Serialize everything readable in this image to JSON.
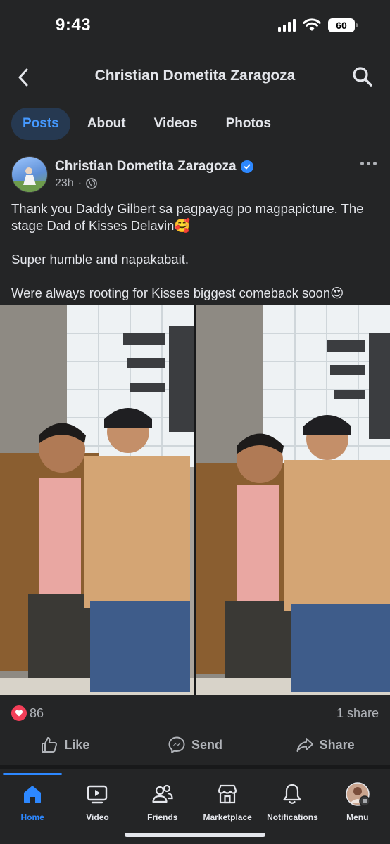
{
  "status_bar": {
    "time": "9:43",
    "battery": "60"
  },
  "header": {
    "title": "Christian Dometita Zaragoza"
  },
  "tabs": [
    {
      "label": "Posts",
      "active": true
    },
    {
      "label": "About",
      "active": false
    },
    {
      "label": "Videos",
      "active": false
    },
    {
      "label": "Photos",
      "active": false
    }
  ],
  "post": {
    "author": "Christian Dometita Zaragoza",
    "time": "23h",
    "separator": "·",
    "text": [
      "Thank you Daddy Gilbert sa pagpayag po magpapicture. The stage Dad of Kisses Delavin🥰",
      "Super humble and napakabait.",
      "Were always rooting for Kisses biggest comeback soon😍"
    ],
    "reaction_count": "86",
    "shares": "1 share"
  },
  "actions": {
    "like": "Like",
    "send": "Send",
    "share": "Share"
  },
  "tab_bar": [
    {
      "label": "Home",
      "icon": "home-icon",
      "active": true
    },
    {
      "label": "Video",
      "icon": "video-icon",
      "active": false
    },
    {
      "label": "Friends",
      "icon": "friends-icon",
      "active": false
    },
    {
      "label": "Marketplace",
      "icon": "marketplace-icon",
      "active": false
    },
    {
      "label": "Notifications",
      "icon": "bell-icon",
      "active": false
    },
    {
      "label": "Menu",
      "icon": "menu-avatar",
      "active": false
    }
  ],
  "colors": {
    "accent": "#2d88ff",
    "background": "#242526",
    "heart": "#f33e58"
  }
}
